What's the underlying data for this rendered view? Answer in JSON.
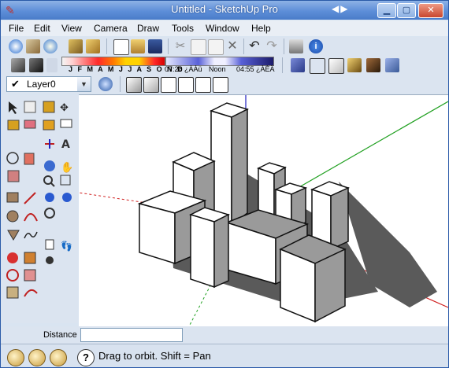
{
  "window": {
    "title": "Untitled - SketchUp Pro",
    "nav_arrows": "◀▶",
    "controls": {
      "minimize": "▁",
      "maximize": "▢",
      "close": "✕"
    }
  },
  "menu": [
    {
      "label": "File"
    },
    {
      "label": "Edit"
    },
    {
      "label": "View"
    },
    {
      "label": "Camera"
    },
    {
      "label": "Draw"
    },
    {
      "label": "Tools"
    },
    {
      "label": "Window"
    },
    {
      "label": "Help"
    }
  ],
  "shadow_settings": {
    "months": "J F M A M J J A S O N D",
    "time_start": "07:28 ¿ÀÀü",
    "noon": "Noon",
    "time_end": "04:55 ¿ÀÈÄ"
  },
  "layer": {
    "name": "Layer0",
    "checked_glyph": "✔",
    "dropdown_glyph": "▼"
  },
  "measurements": {
    "label": "Distance",
    "value": ""
  },
  "status": {
    "help_glyph": "?",
    "message": "Drag to orbit.  Shift = Pan"
  },
  "colors": {
    "title_bar": "#5d8ed8",
    "axis_red": "#d02020",
    "axis_green": "#20a020",
    "axis_blue": "#2020c0",
    "building_top": "#ffffff",
    "building_side": "#9a9a9a",
    "shadow": "#5a5a5a"
  }
}
